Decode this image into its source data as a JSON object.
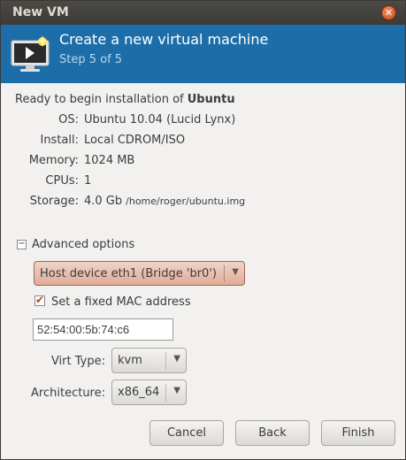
{
  "window": {
    "title": "New VM"
  },
  "header": {
    "title": "Create a new virtual machine",
    "step": "Step 5 of 5"
  },
  "summary": {
    "ready_prefix": "Ready to begin installation of ",
    "os_name": "Ubuntu",
    "rows": [
      {
        "label": "OS:",
        "value": "Ubuntu 10.04 (Lucid Lynx)"
      },
      {
        "label": "Install:",
        "value": "Local CDROM/ISO"
      },
      {
        "label": "Memory:",
        "value": "1024 MB"
      },
      {
        "label": "CPUs:",
        "value": "1"
      },
      {
        "label": "Storage:",
        "value": "4.0 Gb",
        "extra": "/home/roger/ubuntu.img"
      }
    ]
  },
  "advanced": {
    "expander_label": "Advanced options",
    "expander_symbol": "−",
    "network_selected": "Host device eth1 (Bridge 'br0')",
    "mac_checkbox_label": "Set a fixed MAC address",
    "mac_checked": true,
    "mac_value": "52:54:00:5b:74:c6",
    "virt_type_label": "Virt Type:",
    "virt_type_selected": "kvm",
    "arch_label": "Architecture:",
    "arch_selected": "x86_64"
  },
  "buttons": {
    "cancel": "Cancel",
    "back": "Back",
    "finish": "Finish"
  },
  "icons": {
    "close": "close-icon",
    "monitor": "monitor-icon",
    "dropdown": "chevron-down-icon"
  },
  "colors": {
    "header_bg": "#1d6ea8",
    "titlebar_bg": "#3c3b37",
    "window_bg": "#f2f1f0"
  }
}
